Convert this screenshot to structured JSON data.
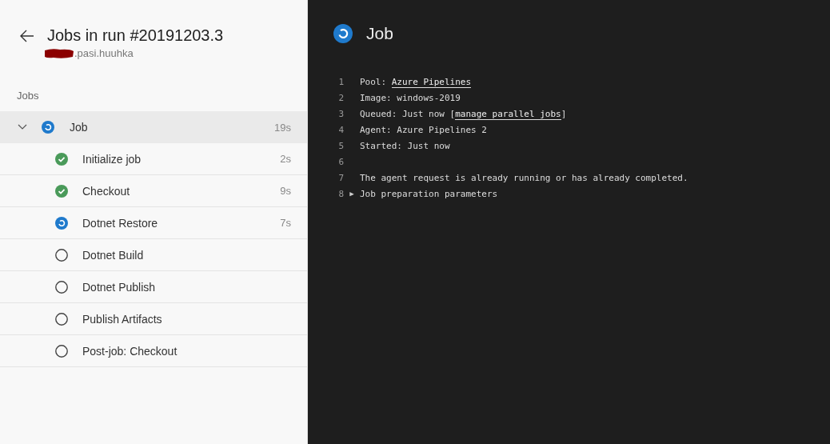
{
  "header": {
    "title": "Jobs in run #20191203.3",
    "subtitle": ".pasi.huuhka"
  },
  "section_label": "Jobs",
  "job": {
    "name": "Job",
    "duration": "19s",
    "kind": "running",
    "expanded": true,
    "selected": true,
    "steps": [
      {
        "name": "Initialize job",
        "duration": "2s",
        "kind": "succeeded"
      },
      {
        "name": "Checkout",
        "duration": "9s",
        "kind": "succeeded"
      },
      {
        "name": "Dotnet Restore",
        "duration": "7s",
        "kind": "running"
      },
      {
        "name": "Dotnet Build",
        "kind": "pending"
      },
      {
        "name": "Dotnet Publish",
        "kind": "pending"
      },
      {
        "name": "Publish Artifacts",
        "kind": "pending"
      },
      {
        "name": "Post-job: Checkout",
        "kind": "pending"
      }
    ]
  },
  "log": {
    "title": "Job",
    "kind": "running",
    "lines": [
      {
        "number": "1",
        "segments": [
          {
            "text": "Pool: ",
            "link": false
          },
          {
            "text": "Azure Pipelines",
            "link": true
          }
        ]
      },
      {
        "number": "2",
        "segments": [
          {
            "text": "Image: windows-2019",
            "link": false
          }
        ]
      },
      {
        "number": "3",
        "segments": [
          {
            "text": "Queued: Just now [",
            "link": false
          },
          {
            "text": "manage parallel jobs",
            "link": true
          },
          {
            "text": "]",
            "link": false
          }
        ]
      },
      {
        "number": "4",
        "segments": [
          {
            "text": "Agent: Azure Pipelines 2",
            "link": false
          }
        ]
      },
      {
        "number": "5",
        "segments": [
          {
            "text": "Started: Just now",
            "link": false
          }
        ]
      },
      {
        "number": "6"
      },
      {
        "number": "7",
        "segments": [
          {
            "text": "The agent request is already running or has already completed.",
            "link": false
          }
        ]
      },
      {
        "number": "8",
        "toggle": "▶",
        "segments": [
          {
            "text": "Job preparation parameters",
            "link": false
          }
        ]
      }
    ]
  }
}
